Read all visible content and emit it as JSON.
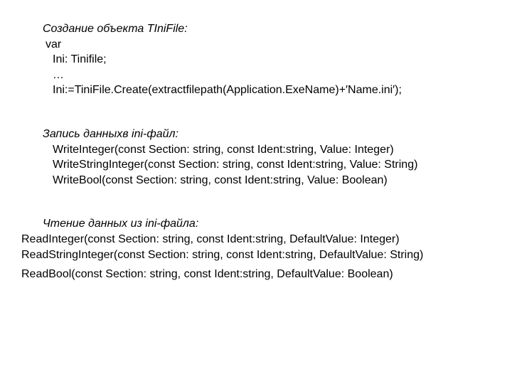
{
  "section1": {
    "title": "Создание объекта TIniFile:",
    "l1": "var",
    "l2": "Ini: Tinifile;",
    "l3": "…",
    "l4": "Ini:=TiniFile.Create(extractfilepath(Application.ExeName)+′Name.ini′);"
  },
  "section2": {
    "title": "Запись данныхв ini-файл:",
    "l1": "WriteInteger(const Section: string, const Ident:string, Value: Integer)",
    "l2": "WriteStringInteger(const Section: string, const Ident:string, Value: String)",
    "l3": "WriteBool(const Section: string, const Ident:string, Value: Boolean)"
  },
  "section3": {
    "title": "Чтение данных из  ini-файла:",
    "l1": "ReadInteger(const Section: string, const Ident:string, DefaultValue:   Integer)",
    "l2": "ReadStringInteger(const Section: string, const Ident:string, DefaultValue: String)",
    "l3": "ReadBool(const Section: string, const Ident:string, DefaultValue: Boolean)"
  }
}
